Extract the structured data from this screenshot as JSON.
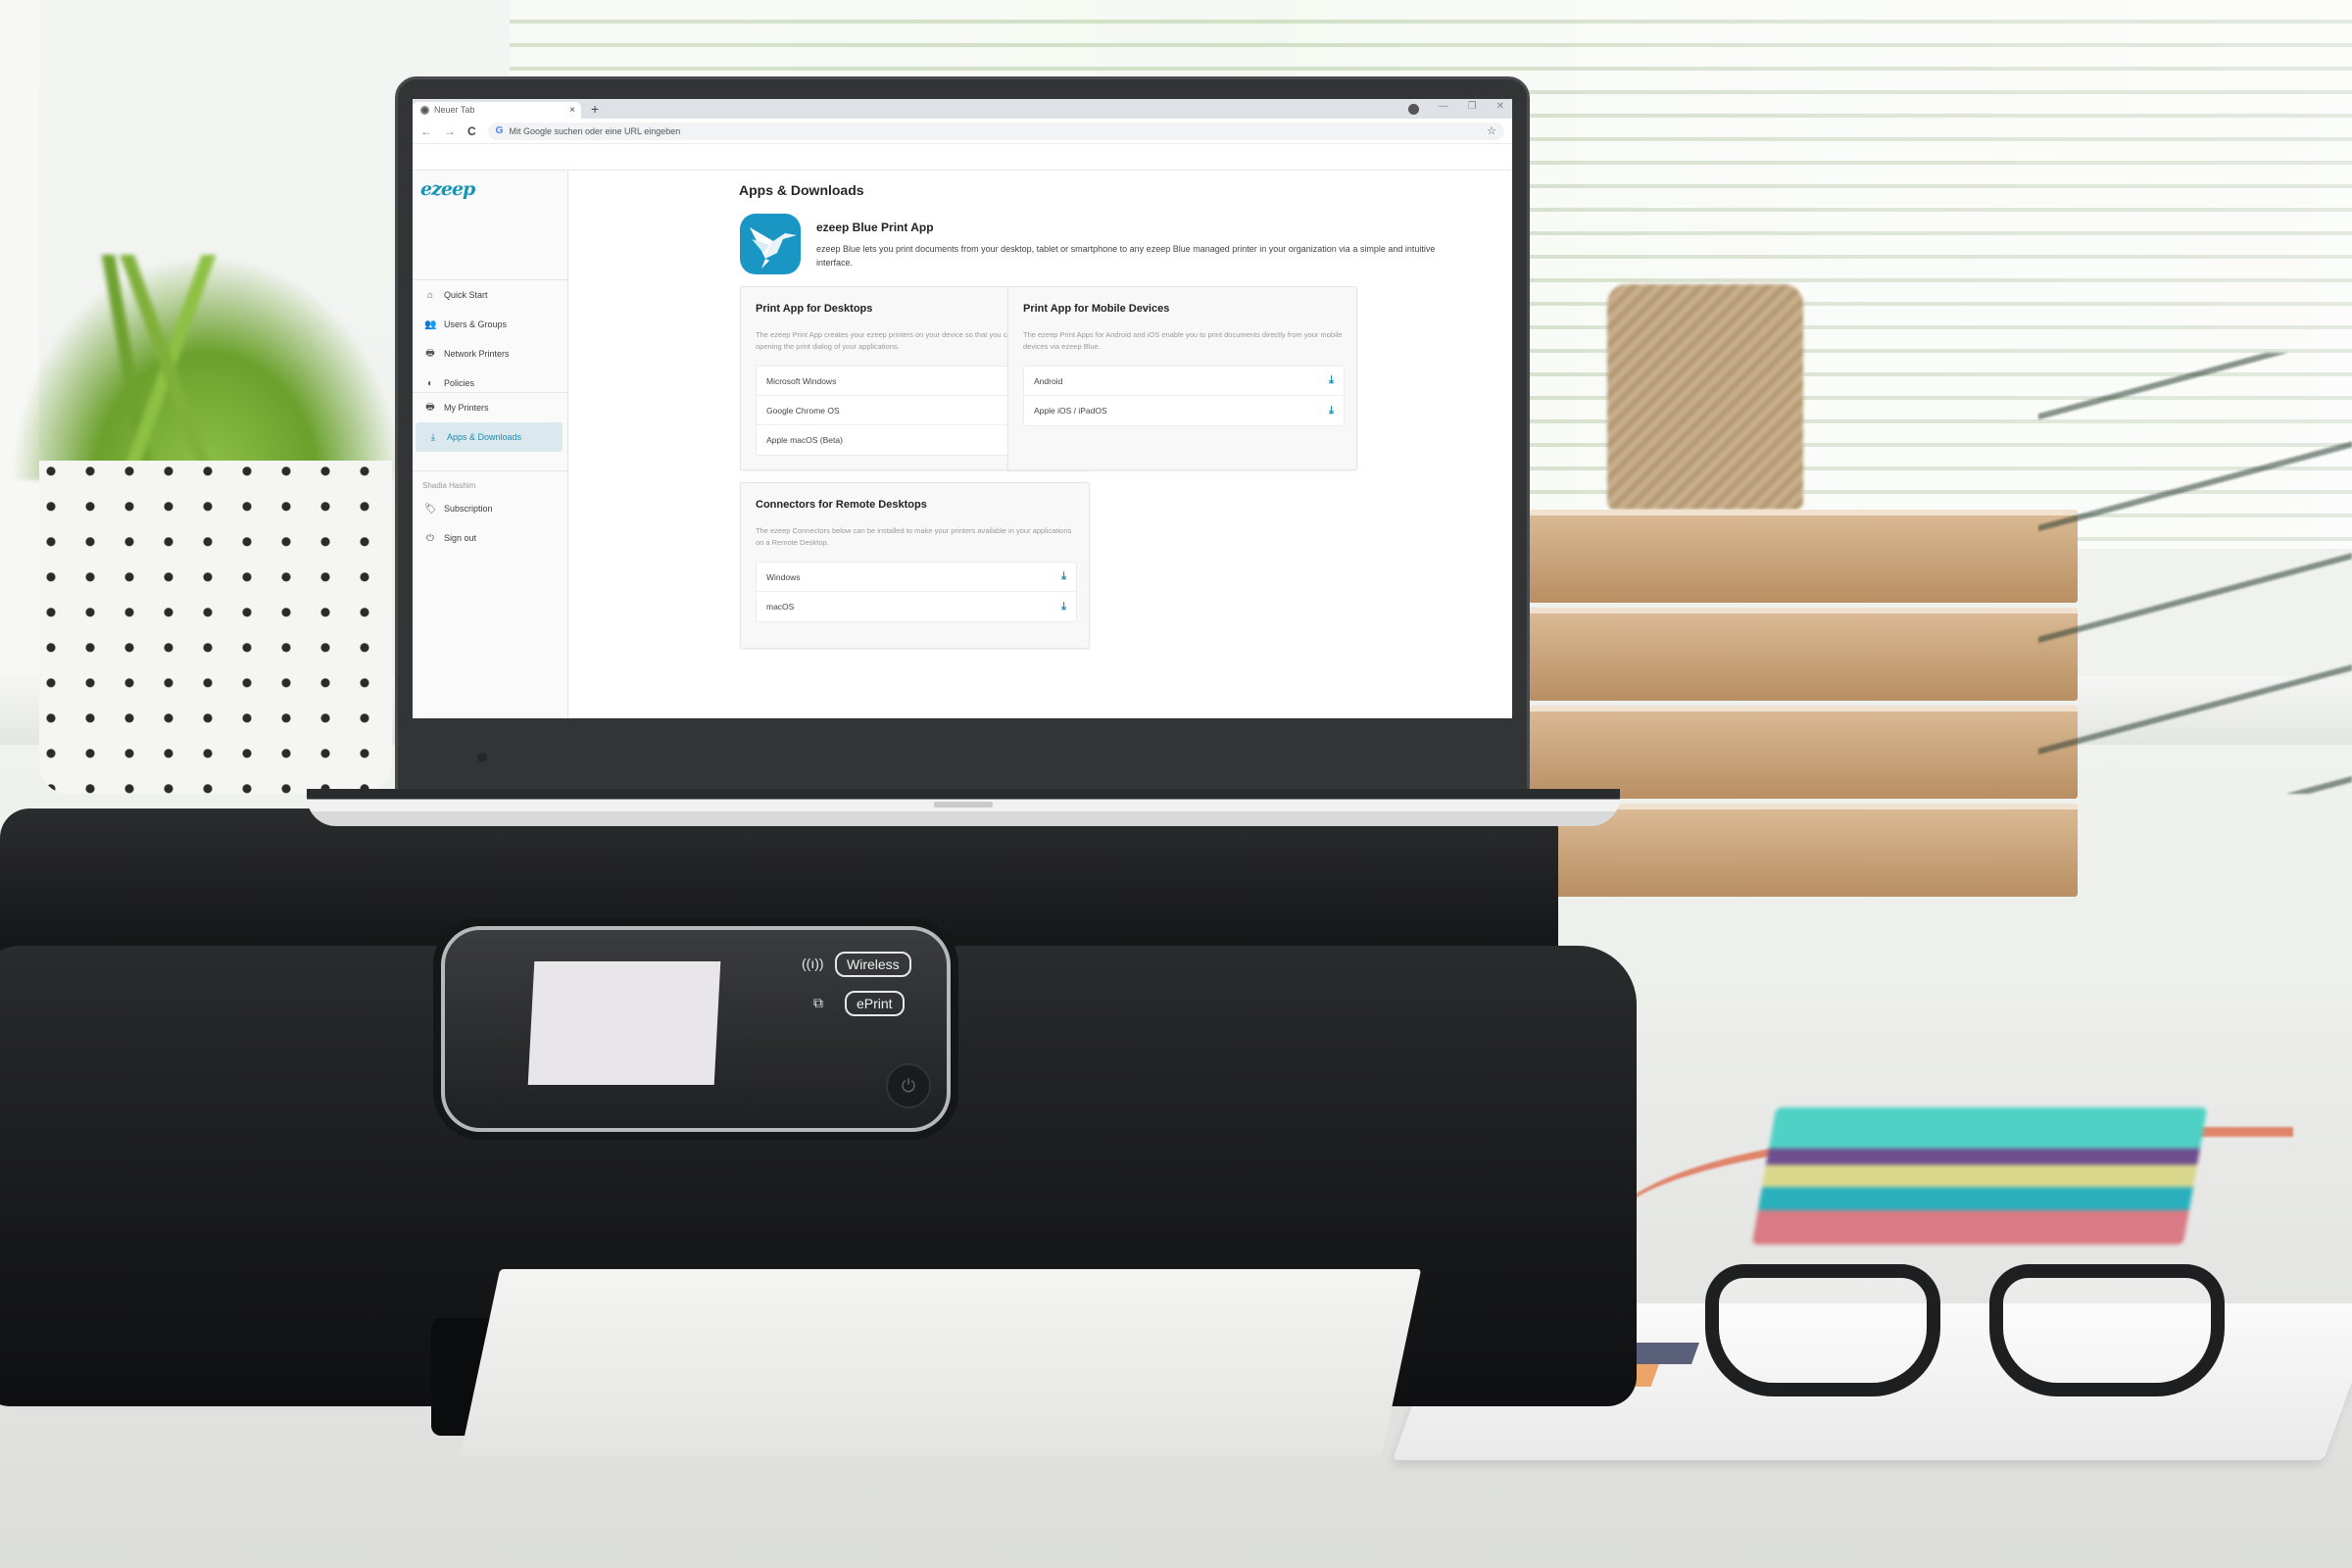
{
  "browser": {
    "tab_title": "Neuer Tab",
    "tab_close": "×",
    "new_tab": "+",
    "omnibox_placeholder": "Mit Google suchen oder eine URL eingeben",
    "omnibox_g": "G",
    "icons": {
      "back": "←",
      "forward": "→",
      "reload": "C",
      "star": "☆",
      "minimize": "—",
      "maximize": "❐",
      "close": "✕"
    }
  },
  "app": {
    "logo": "ezeep",
    "accent_color": "#1b8db0",
    "sidebar": {
      "main_items": [
        {
          "label": "Quick Start",
          "icon": "⌂"
        },
        {
          "label": "Users & Groups",
          "icon": "👥"
        },
        {
          "label": "Network Printers",
          "icon": "🖶"
        },
        {
          "label": "Policies",
          "icon": "◐"
        }
      ],
      "personal_items": [
        {
          "label": "My Printers",
          "icon": "🖶"
        },
        {
          "label": "Apps & Downloads",
          "icon": "⤓",
          "active": true
        }
      ],
      "user_name": "Shadia Hashim",
      "account_items": [
        {
          "label": "Subscription",
          "icon": "🏷"
        },
        {
          "label": "Sign out",
          "icon": "⏻"
        }
      ]
    },
    "main": {
      "page_title": "Apps & Downloads",
      "hero": {
        "title": "ezeep Blue Print App",
        "description": "ezeep Blue lets you print documents from your desktop, tablet or smartphone to any ezeep Blue managed printer in your organization via a simple and intuitive interface."
      },
      "cards": {
        "desktops": {
          "title": "Print App for Desktops",
          "description": "The ezeep Print App creates your ezeep printers on your device so that you can select them when opening the print dialog of your applications.",
          "items": [
            "Microsoft Windows",
            "Google Chrome OS",
            "Apple macOS (Beta)"
          ]
        },
        "mobile": {
          "title": "Print App for Mobile Devices",
          "description": "The ezeep Print Apps for Android and iOS enable you to print documents directly from your mobile devices via ezeep Blue.",
          "items": [
            "Android",
            "Apple iOS / iPadOS"
          ]
        },
        "remote": {
          "title": "Connectors for Remote Desktops",
          "description": "The ezeep Connectors below can be installed to make your printers available in your applications on a Remote Desktop.",
          "items": [
            "Windows",
            "macOS"
          ]
        }
      },
      "download_icon": "⤓"
    }
  },
  "printer_panel": {
    "wireless_label": "Wireless",
    "eprint_label": "ePrint",
    "wireless_icon": "((ı))",
    "eprint_icon": "⧉",
    "power_icon": "⏻"
  }
}
